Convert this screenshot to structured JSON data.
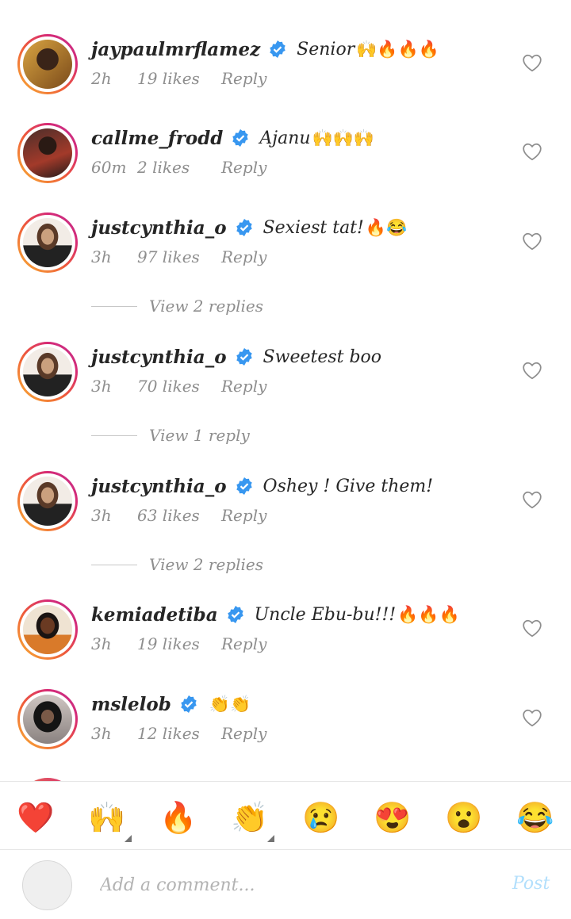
{
  "comments": [
    {
      "username": "jaypaulmrflamez",
      "text": "Senior",
      "emoji": "🙌🔥🔥🔥",
      "time": "2h",
      "likes": "19 likes",
      "reply": "Reply",
      "avatar_color": "#e8b04a"
    },
    {
      "username": "callme_frodd",
      "text": "Ajanu",
      "emoji": "🙌🙌🙌",
      "time": "60m",
      "likes": "2 likes",
      "reply": "Reply",
      "avatar_color": "#7a3b3b"
    },
    {
      "username": "justcynthia_o",
      "text": "Sexiest tat!",
      "emoji": "🔥😂",
      "time": "3h",
      "likes": "97 likes",
      "reply": "Reply",
      "avatar_color": "#c9a58a"
    },
    {
      "username": "justcynthia_o",
      "text": "Sweetest boo",
      "emoji": "",
      "time": "3h",
      "likes": "70 likes",
      "reply": "Reply",
      "avatar_color": "#c9a58a"
    },
    {
      "username": "justcynthia_o",
      "text": "Oshey ! Give them!",
      "emoji": "",
      "time": "3h",
      "likes": "63 likes",
      "reply": "Reply",
      "avatar_color": "#c9a58a"
    },
    {
      "username": "kemiadetiba",
      "text": "Uncle Ebu-bu!!!",
      "emoji": "🔥🔥🔥",
      "time": "3h",
      "likes": "19 likes",
      "reply": "Reply",
      "avatar_color": "#c8763a"
    },
    {
      "username": "mslelob",
      "text": "",
      "emoji": "👏👏",
      "time": "3h",
      "likes": "12 likes",
      "reply": "Reply",
      "avatar_color": "#4a4a4a"
    }
  ],
  "view_replies": [
    "View 2 replies",
    "View 1 reply",
    "View 2 replies"
  ],
  "quick_emojis": [
    "❤️",
    "🙌",
    "🔥",
    "👏",
    "😢",
    "😍",
    "😮",
    "😂"
  ],
  "composer": {
    "placeholder": "Add a comment...",
    "post_label": "Post"
  },
  "colors": {
    "verified": "#3897f0",
    "meta": "#8e8e8e",
    "post_disabled": "#b2dffc"
  }
}
